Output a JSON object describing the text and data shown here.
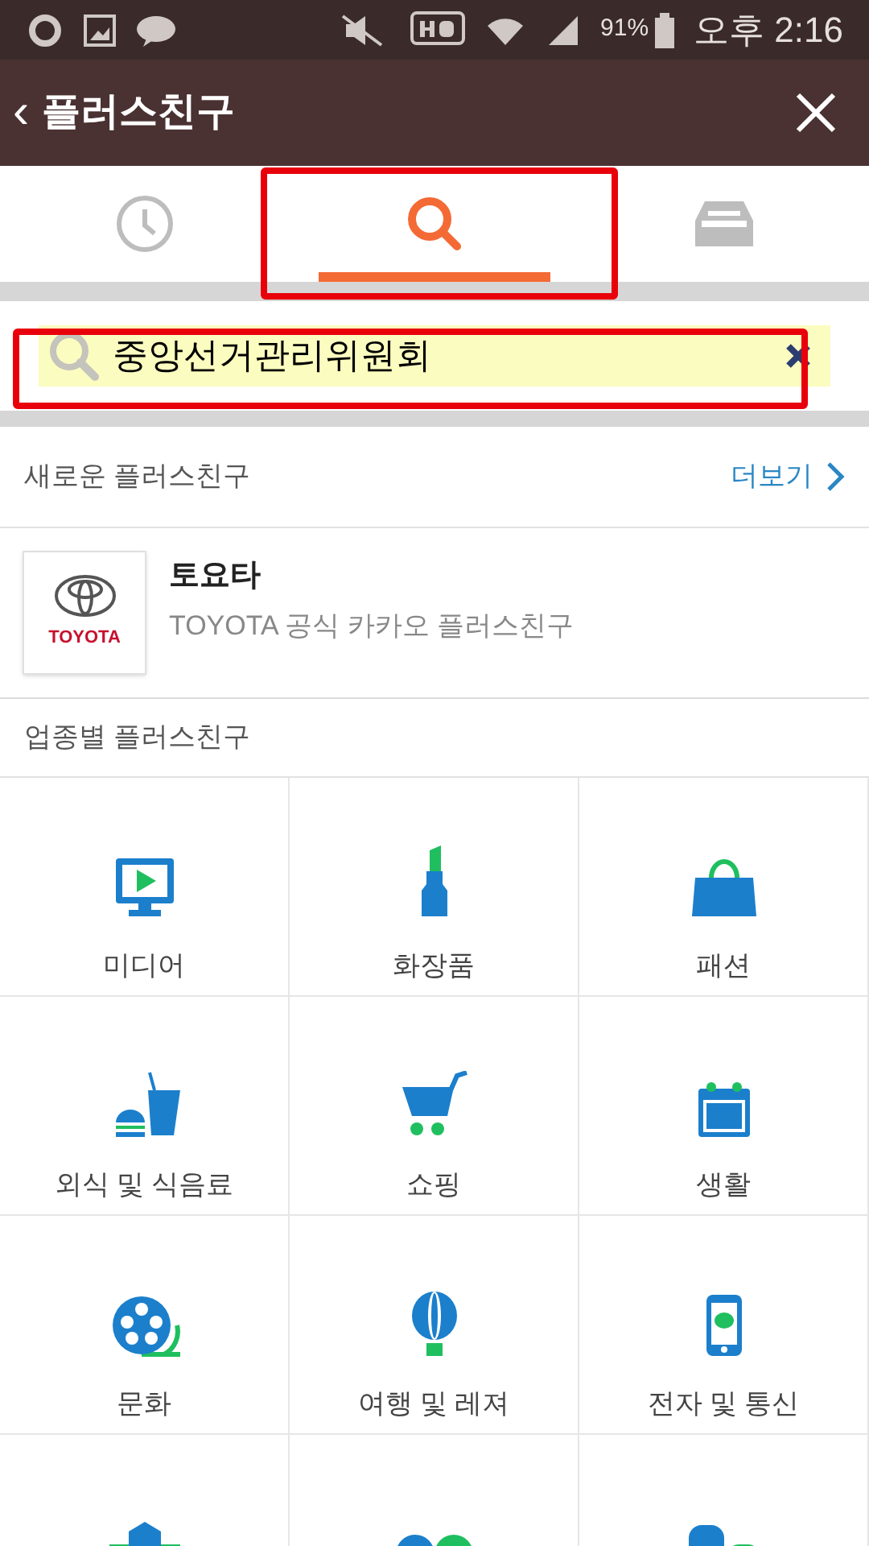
{
  "status_bar": {
    "battery": "91%",
    "time": "오후 2:16"
  },
  "header": {
    "back": "‹",
    "title": "플러스친구"
  },
  "tabs": [
    {
      "selected": false
    },
    {
      "selected": true
    },
    {
      "selected": false
    }
  ],
  "search": {
    "value": "중앙선거관리위원회"
  },
  "new_friends": {
    "title": "새로운 플러스친구",
    "more": "더보기",
    "items": [
      {
        "name": "토요타",
        "description": "TOYOTA 공식 카카오 플러스친구",
        "logo_text": "TOYOTA"
      }
    ]
  },
  "categories": {
    "title": "업종별 플러스친구",
    "items": [
      {
        "label": "미디어"
      },
      {
        "label": "화장품"
      },
      {
        "label": "패션"
      },
      {
        "label": "외식 및 식음료"
      },
      {
        "label": "쇼핑"
      },
      {
        "label": "생활"
      },
      {
        "label": "문화"
      },
      {
        "label": "여행 및 레져"
      },
      {
        "label": "전자 및 통신"
      }
    ]
  }
}
